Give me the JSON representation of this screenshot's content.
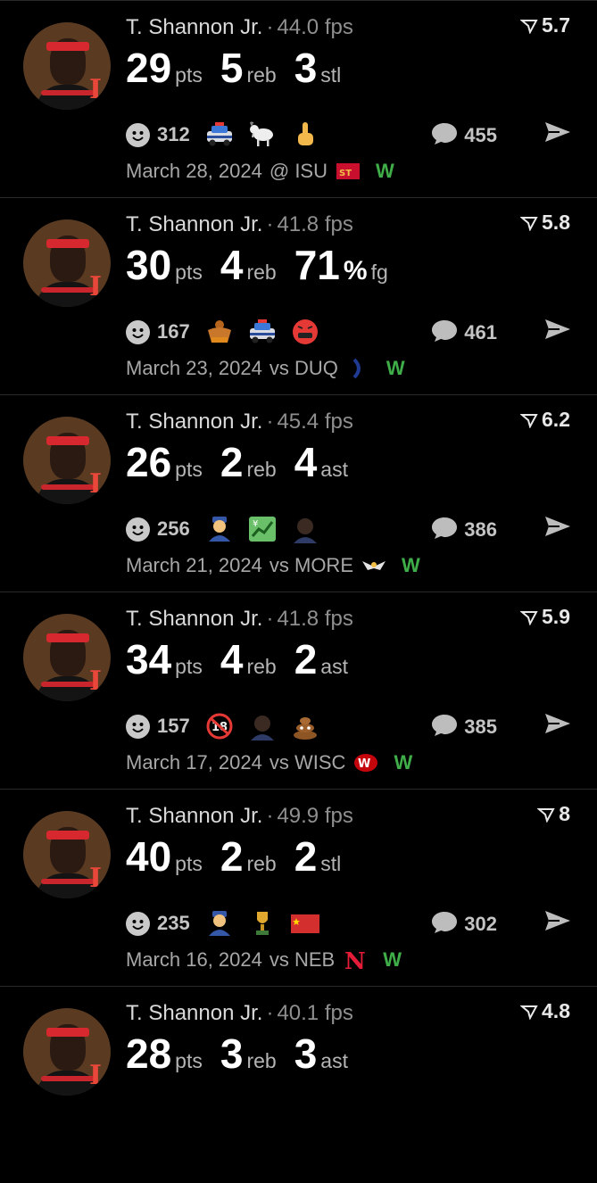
{
  "colors": {
    "background": "#000000",
    "win": "#3fae49",
    "muted": "#8f8f8f"
  },
  "cards": [
    {
      "player": "T. Shannon Jr.",
      "sep": "·",
      "fps": "44.0 fps",
      "rating": "5.7",
      "stats": [
        {
          "num": "29",
          "label": "pts"
        },
        {
          "num": "5",
          "label": "reb"
        },
        {
          "num": "3",
          "label": "stl"
        }
      ],
      "reactions_count": "312",
      "emojis": [
        "police-car-icon",
        "goat-icon",
        "middle-finger-icon"
      ],
      "comments": "455",
      "date": "March 28, 2024",
      "venue": "@ ISU",
      "team_logo": "isu-logo-icon",
      "result": "W"
    },
    {
      "player": "T. Shannon Jr.",
      "sep": "·",
      "fps": "41.8 fps",
      "rating": "5.8",
      "stats": [
        {
          "num": "30",
          "label": "pts"
        },
        {
          "num": "4",
          "label": "reb"
        },
        {
          "num": "71",
          "label": "fg",
          "pct": "%"
        }
      ],
      "reactions_count": "167",
      "emojis": [
        "bodybuilder-icon",
        "police-car-icon",
        "angry-cursing-face-icon"
      ],
      "comments": "461",
      "date": "March 23, 2024",
      "venue": "vs DUQ",
      "team_logo": "duq-logo-icon",
      "result": "W"
    },
    {
      "player": "T. Shannon Jr.",
      "sep": "·",
      "fps": "45.4 fps",
      "rating": "6.2",
      "stats": [
        {
          "num": "26",
          "label": "pts"
        },
        {
          "num": "2",
          "label": "reb"
        },
        {
          "num": "4",
          "label": "ast"
        }
      ],
      "reactions_count": "256",
      "emojis": [
        "police-officer-icon",
        "chart-yen-icon",
        "face-icon"
      ],
      "comments": "386",
      "date": "March 21, 2024",
      "venue": "vs MORE",
      "team_logo": "eagle-logo-icon",
      "result": "W"
    },
    {
      "player": "T. Shannon Jr.",
      "sep": "·",
      "fps": "41.8 fps",
      "rating": "5.9",
      "stats": [
        {
          "num": "34",
          "label": "pts"
        },
        {
          "num": "4",
          "label": "reb"
        },
        {
          "num": "2",
          "label": "ast"
        }
      ],
      "reactions_count": "157",
      "emojis": [
        "no-under-18-icon",
        "face-icon",
        "pile-of-poo-icon"
      ],
      "comments": "385",
      "date": "March 17, 2024",
      "venue": "vs WISC",
      "team_logo": "wisc-logo-icon",
      "result": "W"
    },
    {
      "player": "T. Shannon Jr.",
      "sep": "·",
      "fps": "49.9 fps",
      "rating": "8",
      "stats": [
        {
          "num": "40",
          "label": "pts"
        },
        {
          "num": "2",
          "label": "reb"
        },
        {
          "num": "2",
          "label": "stl"
        }
      ],
      "reactions_count": "235",
      "emojis": [
        "police-officer-icon",
        "trophy-icon",
        "china-flag-icon"
      ],
      "comments": "302",
      "date": "March 16, 2024",
      "venue": "vs NEB",
      "team_logo": "neb-logo-icon",
      "result": "W"
    },
    {
      "player": "T. Shannon Jr.",
      "sep": "·",
      "fps": "40.1 fps",
      "rating": "4.8",
      "stats": [
        {
          "num": "28",
          "label": "pts"
        },
        {
          "num": "3",
          "label": "reb"
        },
        {
          "num": "3",
          "label": "ast"
        }
      ],
      "reactions_count": "",
      "emojis": [],
      "comments": "",
      "date": "",
      "venue": "",
      "team_logo": "",
      "result": ""
    }
  ]
}
